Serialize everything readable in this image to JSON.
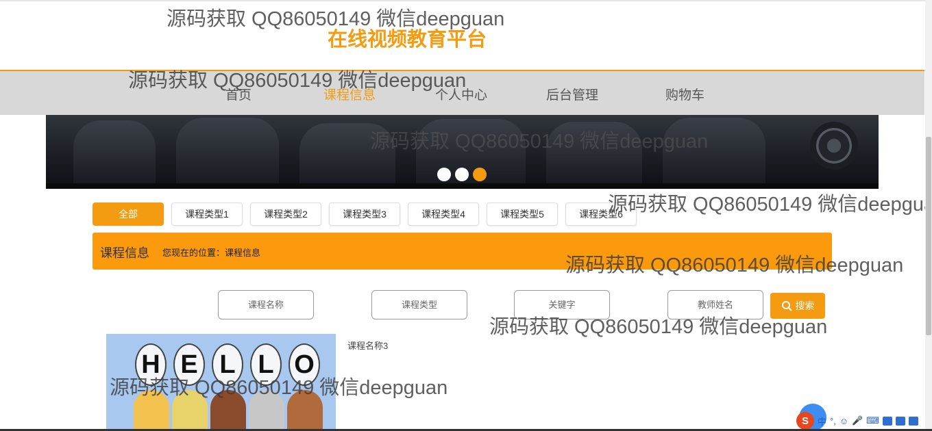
{
  "site": {
    "title": "在线视频教育平台"
  },
  "nav": {
    "items": [
      {
        "label": "首页"
      },
      {
        "label": "课程信息",
        "active": true
      },
      {
        "label": "个人中心"
      },
      {
        "label": "后台管理"
      },
      {
        "label": "购物车"
      }
    ]
  },
  "carousel": {
    "dot_count": 3,
    "active_index": 2
  },
  "categories": {
    "items": [
      {
        "label": "全部",
        "active": true
      },
      {
        "label": "课程类型1"
      },
      {
        "label": "课程类型2"
      },
      {
        "label": "课程类型3"
      },
      {
        "label": "课程类型4"
      },
      {
        "label": "课程类型5"
      },
      {
        "label": "课程类型6"
      }
    ]
  },
  "info_bar": {
    "title": "课程信息",
    "location": "您现在的位置：课程信息"
  },
  "search": {
    "course_name_placeholder": "课程名称",
    "course_type_placeholder": "课程类型",
    "keyword_placeholder": "关键字",
    "teacher_placeholder": "教师姓名",
    "button_label": "搜索"
  },
  "course": {
    "image_text": [
      "H",
      "E",
      "L",
      "L",
      "O"
    ],
    "name": "课程名称3"
  },
  "watermark": {
    "text": "源码获取 QQ86050149 微信deepguan"
  },
  "ime": {
    "logo": "S",
    "items": [
      "中",
      "°,",
      "☺",
      "🎤",
      "⌨"
    ]
  },
  "colors": {
    "accent": "#f39c12",
    "nav_bg": "#d8d8d8"
  }
}
